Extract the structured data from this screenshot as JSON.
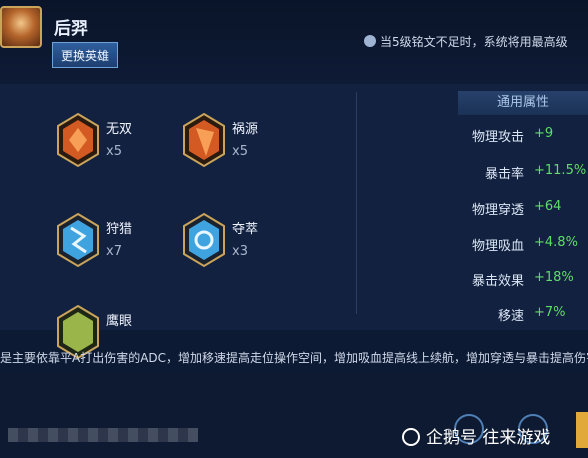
{
  "hero": {
    "name": "后羿",
    "change_button": "更换英雄"
  },
  "notice": {
    "text": "当5级铭文不足时，系统将用最高级"
  },
  "runes": [
    {
      "name": "无双",
      "count": "x5",
      "color": "#d45a23"
    },
    {
      "name": "祸源",
      "count": "x5",
      "color": "#d45a23"
    },
    {
      "name": "狩猎",
      "count": "x7",
      "color": "#3fa3df"
    },
    {
      "name": "夺萃",
      "count": "x3",
      "color": "#3fa3df"
    },
    {
      "name": "鹰眼",
      "count": "",
      "color": "#9ab64a"
    }
  ],
  "attributes": {
    "header": "通用属性",
    "rows": [
      {
        "label": "物理攻击",
        "value": "+9"
      },
      {
        "label": "暴击率",
        "value": "+11.5%"
      },
      {
        "label": "物理穿透",
        "value": "+64"
      },
      {
        "label": "物理吸血",
        "value": "+4.8%"
      },
      {
        "label": "暴击效果",
        "value": "+18%"
      },
      {
        "label": "移速",
        "value": "+7%"
      }
    ]
  },
  "description": "是主要依靠平A打出伤害的ADC，增加移速提高走位操作空间，增加吸血提高线上续航，增加穿透与暴击提高伤害",
  "watermark": "企鹅号 往来游戏"
}
